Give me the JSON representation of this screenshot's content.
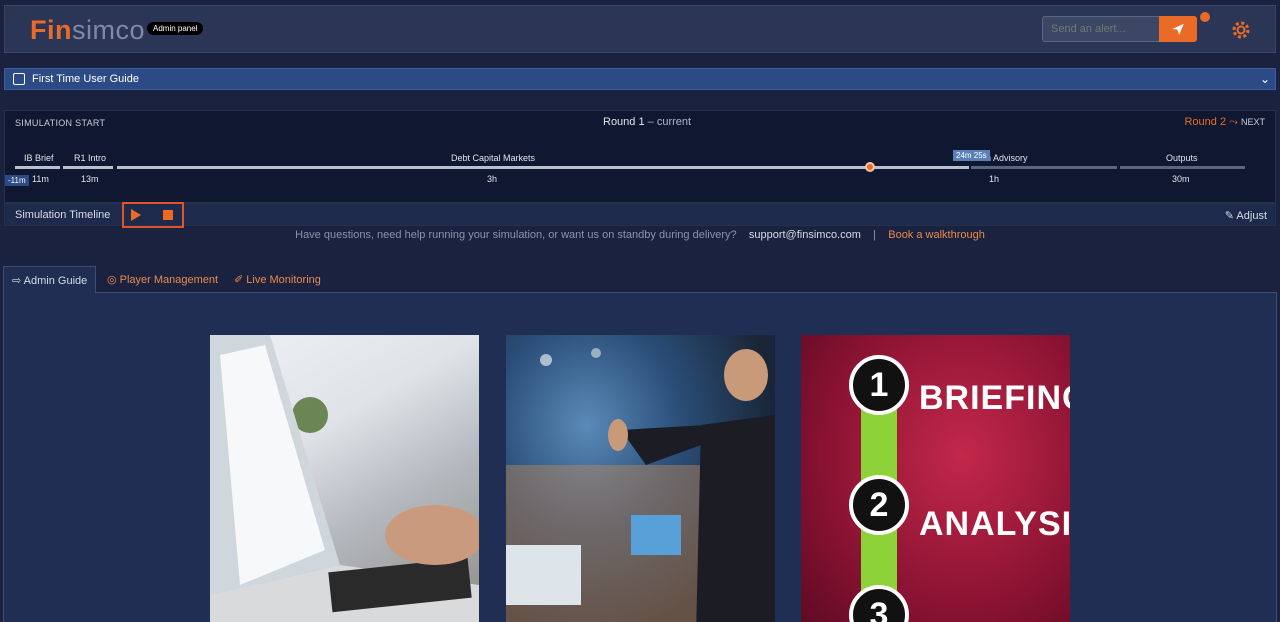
{
  "header": {
    "logo_fin": "Fin",
    "logo_sim": "simco",
    "badge": "Admin panel",
    "alert_placeholder": "Send an alert...",
    "brand_color": "#ea6a28"
  },
  "guide": {
    "label": "First Time User Guide"
  },
  "timeline": {
    "start": "SIMULATION START",
    "round": "Round 1",
    "round_state": " – current",
    "next_round": "Round 2",
    "next": "NEXT",
    "now_tag": "24m 25s",
    "neg_tag": "-11m",
    "segments": [
      {
        "label": "IB Brief",
        "duration": "11m"
      },
      {
        "label": "R1 Intro",
        "duration": "13m"
      },
      {
        "label": "Debt Capital Markets",
        "duration": "3h"
      },
      {
        "label": "n Advisory",
        "duration": "1h"
      },
      {
        "label": "Outputs",
        "duration": "30m"
      }
    ]
  },
  "controls": {
    "label": "Simulation Timeline",
    "adjust": "Adjust"
  },
  "help": {
    "text": "Have questions, need help running your simulation, or want us on standby during delivery?",
    "email": "support@finsimco.com",
    "sep": "|",
    "walkthrough": "Book a walkthrough"
  },
  "tabs": [
    {
      "label": "Admin Guide"
    },
    {
      "label": "Player Management"
    },
    {
      "label": "Live Monitoring"
    }
  ],
  "cards": {
    "steps": [
      {
        "num": "1",
        "text": "BRIEFING"
      },
      {
        "num": "2",
        "text": "ANALYSIS"
      },
      {
        "num": "3",
        "text": ""
      }
    ]
  }
}
